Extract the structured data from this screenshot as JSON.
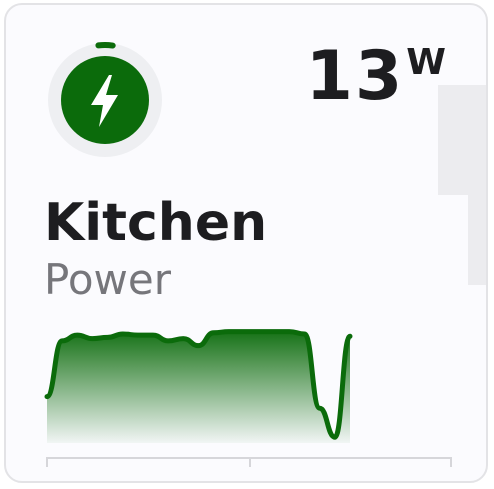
{
  "card": {
    "name": "Kitchen",
    "subtitle": "Power",
    "value": "13",
    "unit": "W",
    "icon": "lightning-bolt-icon"
  },
  "colors": {
    "accent": "#0b6b0b",
    "ring": "#eeeff2",
    "title": "#1d1d20",
    "subtitle": "#76767b"
  },
  "sparkline": {
    "values": [
      0.4,
      0.88,
      0.93,
      0.9,
      0.91,
      0.94,
      0.93,
      0.93,
      0.88,
      0.9,
      0.84,
      0.95,
      0.96,
      0.96,
      0.96,
      0.96,
      0.96,
      0.94,
      0.3,
      0.05,
      0.92
    ],
    "fill_fraction": 0.75
  }
}
